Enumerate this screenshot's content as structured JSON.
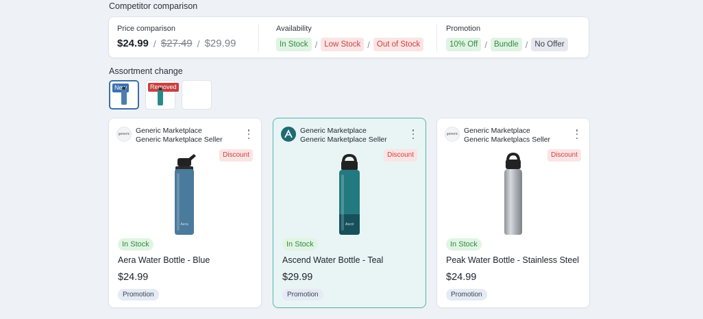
{
  "competitor": {
    "title": "Competitor comparison",
    "price": {
      "label": "Price comparison",
      "main": "$24.99",
      "alt1": "$27.49",
      "alt2": "$29.99"
    },
    "availability": {
      "label": "Availability",
      "chips": [
        "In Stock",
        "Low Stock",
        "Out of Stock"
      ]
    },
    "promotion": {
      "label": "Promotion",
      "chips": [
        "10% Off",
        "Bundle",
        "No Offer"
      ]
    }
  },
  "assortment": {
    "title": "Assortment change",
    "thumbs": [
      {
        "badge": "New",
        "color": "#4a7fb0"
      },
      {
        "badge": "Removed",
        "color": "#2a8a8a"
      },
      {
        "badge": "",
        "color": ""
      }
    ]
  },
  "products": [
    {
      "seller": "Generic Marketplace",
      "seller_sub": "Generic Marketplace Seller",
      "logo_text": "generic",
      "discount": "Discount",
      "stock": "In Stock",
      "name": "Aera Water Bottle - Blue",
      "price": "$24.99",
      "promo": "Promotion",
      "color": "#4a7a9c"
    },
    {
      "seller": "Generic Marketplace",
      "seller_sub": "Generic Marketplace Seller",
      "logo_text": "",
      "discount": "Discount",
      "stock": "In Stock",
      "name": "Ascend Water Bottle - Teal",
      "price": "$29.99",
      "promo": "Promotion",
      "color": "#227a80"
    },
    {
      "seller": "Generic Marketplace",
      "seller_sub": "Generic Marketplacs Seller",
      "logo_text": "generic",
      "discount": "Discount",
      "stock": "In Stock",
      "name": "Peak Water Bottle - Stainless Steel",
      "price": "$24.99",
      "promo": "Promotion",
      "color": "#a8adb3"
    }
  ]
}
